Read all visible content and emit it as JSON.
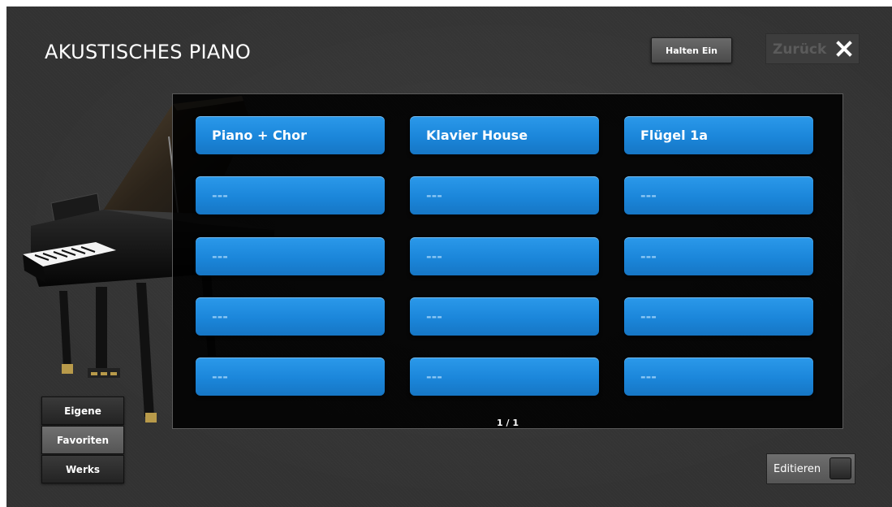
{
  "header": {
    "title": "AKUSTISCHES PIANO",
    "hold_button_label": "Halten Ein",
    "back_button_label": "Zurück"
  },
  "sound_grid": {
    "items": [
      "Piano + Chor",
      "Klavier House",
      "Flügel 1a",
      "---",
      "---",
      "---",
      "---",
      "---",
      "---",
      "---",
      "---",
      "---",
      "---",
      "---",
      "---"
    ],
    "page_indicator": "1 / 1"
  },
  "sidebar": {
    "items": [
      {
        "label": "Eigene",
        "active": false
      },
      {
        "label": "Favoriten",
        "active": true
      },
      {
        "label": "Werks",
        "active": false
      }
    ]
  },
  "footer": {
    "edit_label": "Editieren"
  },
  "colors": {
    "accent_blue": "#1b86da",
    "background": "#333333"
  }
}
